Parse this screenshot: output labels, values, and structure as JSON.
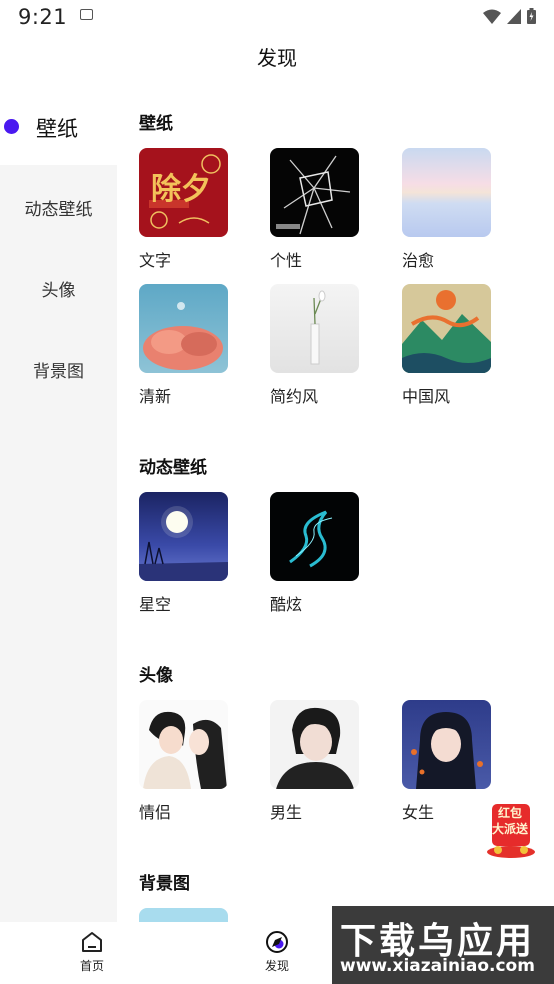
{
  "status_bar": {
    "time": "9:21"
  },
  "header": {
    "title": "发现"
  },
  "sidebar": {
    "items": [
      {
        "label": "壁纸"
      },
      {
        "label": "动态壁纸"
      },
      {
        "label": "头像"
      },
      {
        "label": "背景图"
      }
    ]
  },
  "sections": {
    "wallpaper": {
      "title": "壁纸",
      "tiles": [
        {
          "label": "文字",
          "art_text": "除夕"
        },
        {
          "label": "个性"
        },
        {
          "label": "治愈"
        },
        {
          "label": "清新"
        },
        {
          "label": "简约风"
        },
        {
          "label": "中国风"
        }
      ]
    },
    "live": {
      "title": "动态壁纸",
      "tiles": [
        {
          "label": "星空"
        },
        {
          "label": "酷炫"
        }
      ]
    },
    "avatar": {
      "title": "头像",
      "tiles": [
        {
          "label": "情侣"
        },
        {
          "label": "男生"
        },
        {
          "label": "女生"
        }
      ]
    },
    "background": {
      "title": "背景图"
    }
  },
  "bottom_nav": {
    "home_label": "首页",
    "discover_label": "发现"
  },
  "badge": {
    "line1": "红包",
    "line2": "大派送"
  },
  "watermark": {
    "main": "下载乌应用",
    "sub": "www.xiazainiao.com"
  },
  "colors": {
    "accent": "#4a19f0",
    "sidebar_bg": "#f5f5f5"
  }
}
